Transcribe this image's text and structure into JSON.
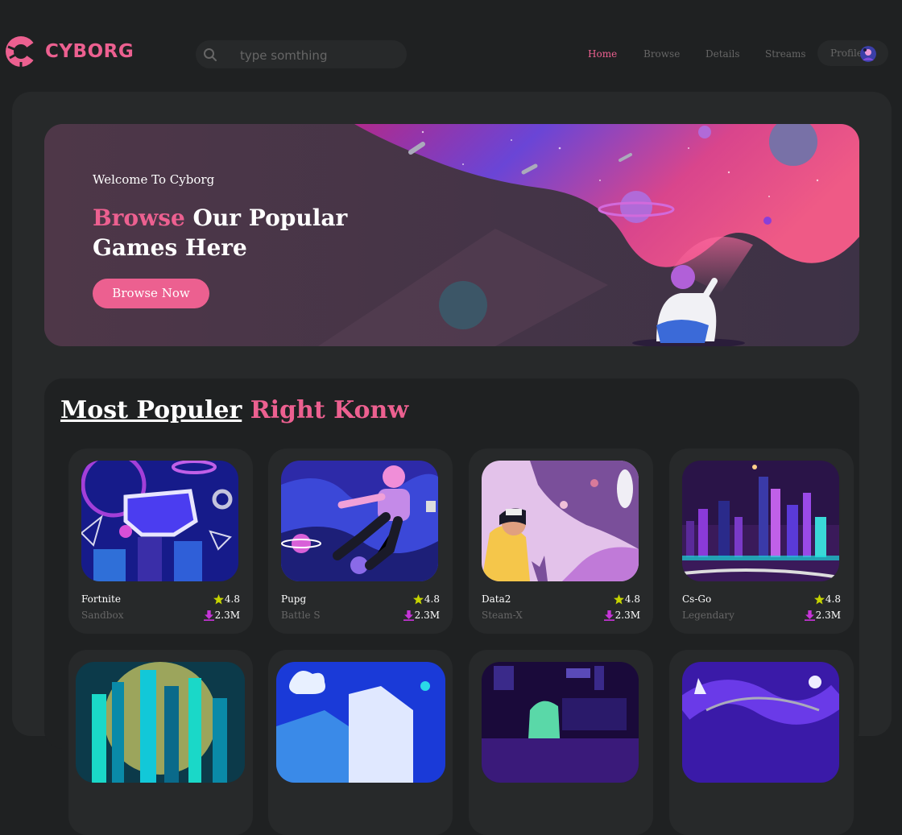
{
  "brand": {
    "name": "CYBORG",
    "accent": "#ec6090"
  },
  "search": {
    "placeholder": "type somthing",
    "icon": "search-icon"
  },
  "nav": {
    "items": [
      {
        "label": "Home",
        "active": true
      },
      {
        "label": "Browse",
        "active": false
      },
      {
        "label": "Details",
        "active": false
      },
      {
        "label": "Streams",
        "active": false
      }
    ],
    "profile_label": "Profile"
  },
  "banner": {
    "welcome": "Welcome To Cyborg",
    "heading_accent": "Browse",
    "heading_rest": "Our Popular Games Here",
    "button_label": "Browse Now"
  },
  "popular": {
    "title_underlined": "Most Populer",
    "title_accent": "Right Konw",
    "cards": [
      {
        "name": "Fortnite",
        "category": "Sandbox",
        "rating": "4.8",
        "downloads": "2.3M"
      },
      {
        "name": "Pupg",
        "category": "Battle S",
        "rating": "4.8",
        "downloads": "2.3M"
      },
      {
        "name": "Data2",
        "category": "Steam-X",
        "rating": "4.8",
        "downloads": "2.3M"
      },
      {
        "name": "Cs-Go",
        "category": "Legendary",
        "rating": "4.8",
        "downloads": "2.3M"
      }
    ]
  }
}
